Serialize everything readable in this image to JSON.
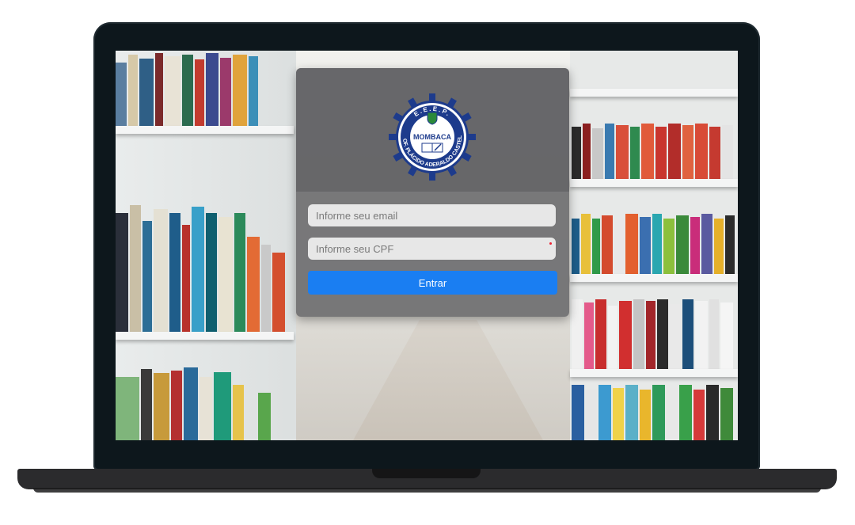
{
  "logo": {
    "top_text": "E.E.E.P.",
    "center_text": "MOMBACA",
    "ring_text": "PROF. PLÁCIDO ADERALDO CASTELO",
    "ring_color": "#1d3b8c",
    "gear_color": "#1d3b8c",
    "icon": "school-emblem-icon"
  },
  "form": {
    "email_placeholder": "Informe seu email",
    "cpf_placeholder": "Informe seu CPF",
    "submit_label": "Entrar",
    "accent_color": "#1a7ef2"
  }
}
